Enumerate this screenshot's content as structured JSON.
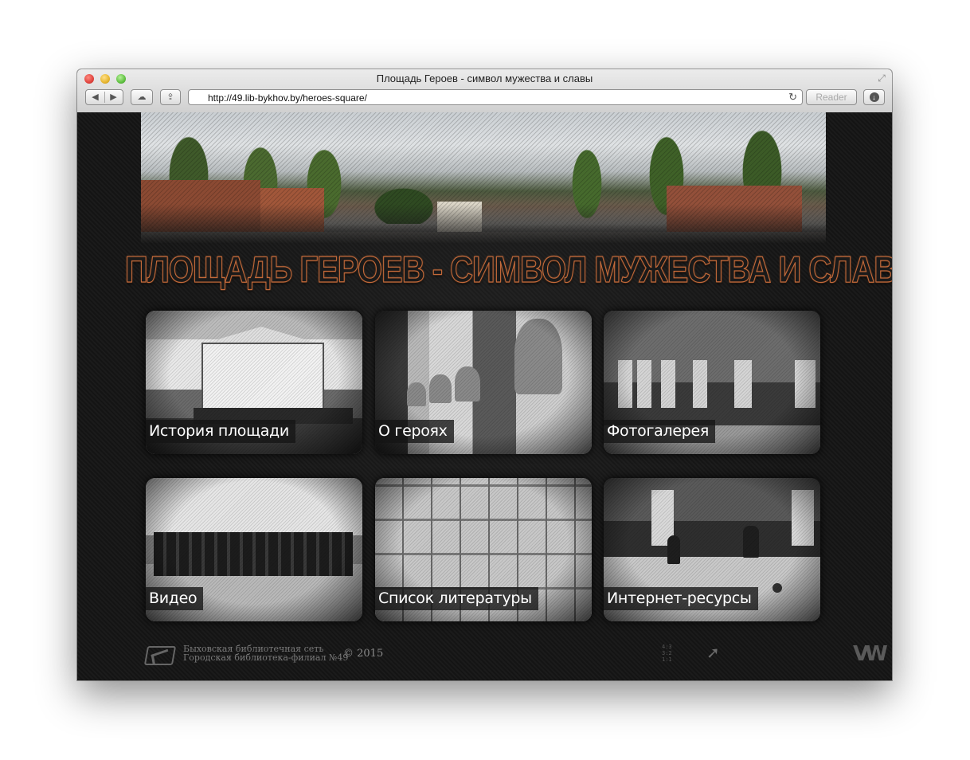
{
  "window": {
    "title": "Площадь Героев - символ мужества и славы",
    "url": "http://49.lib-bykhov.by/heroes-square/",
    "reader_label": "Reader",
    "back_glyph": "◀",
    "forward_glyph": "▶",
    "reload_glyph": "↻",
    "cloud_glyph": "☁",
    "share_glyph": "⇪",
    "download_glyph": "↓",
    "fullscreen_glyph": "⤢"
  },
  "page": {
    "title": "ПЛОЩАДЬ ГЕРОЕВ - СИМВОЛ МУЖЕСТВА И СЛАВЫ",
    "tiles": [
      {
        "label": "История площади",
        "icon": "photo-square-history"
      },
      {
        "label": "О героях",
        "icon": "photo-hero-busts"
      },
      {
        "label": "Фотогалерея",
        "icon": "photo-monuments"
      },
      {
        "label": "Видео",
        "icon": "photo-ceremony"
      },
      {
        "label": "Список литературы",
        "icon": "photo-memorial-board"
      },
      {
        "label": "Интернет-ресурсы",
        "icon": "photo-children-playing"
      }
    ]
  },
  "footer": {
    "org_line1": "Быховская библиотечная сеть",
    "org_line2": "Городская библиотека-филиал №49",
    "copyright": "© 2015",
    "ratios": [
      "4:3",
      "3:2",
      "1:1"
    ],
    "arrow_glyph": "➚",
    "vw_logo": "VW"
  },
  "colors": {
    "title_outline": "#c46a3a",
    "background": "#151515",
    "label_bg": "#141414"
  }
}
